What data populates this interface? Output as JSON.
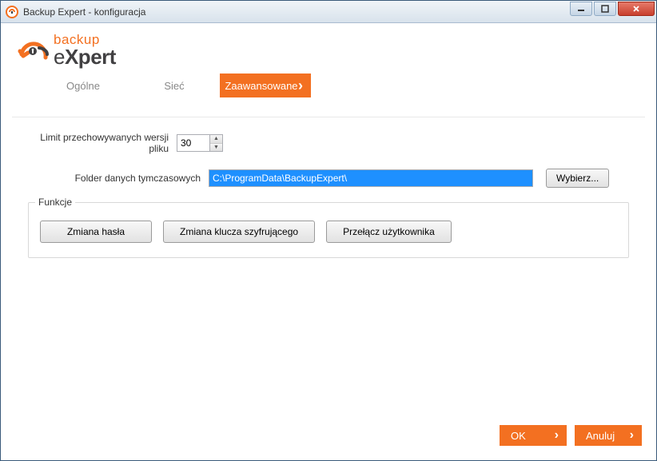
{
  "window": {
    "title": "Backup Expert - konfiguracja"
  },
  "logo": {
    "top": "backup",
    "bottom_prefix": "e",
    "bottom_rest": "Xpert"
  },
  "tabs": {
    "general": "Ogólne",
    "network": "Sieć",
    "advanced": "Zaawansowane"
  },
  "form": {
    "version_limit_label": "Limit przechowywanych wersji pliku",
    "version_limit_value": "30",
    "temp_folder_label": "Folder danych tymczasowych",
    "temp_folder_value": "C:\\ProgramData\\BackupExpert\\",
    "browse_label": "Wybierz..."
  },
  "functions": {
    "legend": "Funkcje",
    "change_password": "Zmiana hasła",
    "change_key": "Zmiana klucza szyfrującego",
    "switch_user": "Przełącz użytkownika"
  },
  "footer": {
    "ok": "OK",
    "cancel": "Anuluj"
  }
}
